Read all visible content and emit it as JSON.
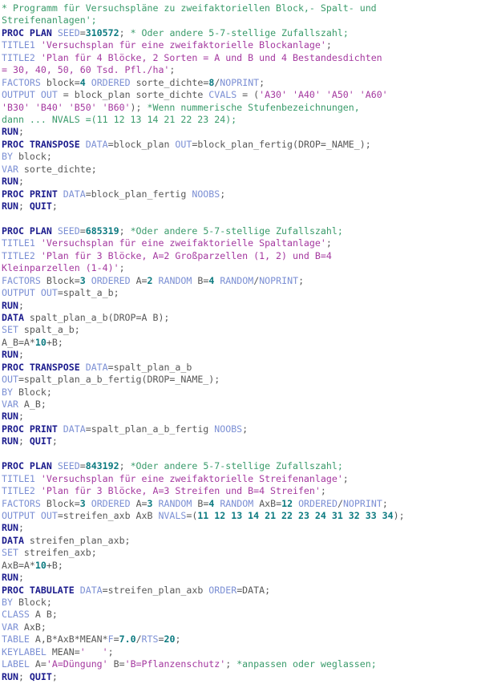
{
  "document": {
    "kind": "sas-program-source-listing",
    "language": "SAS",
    "colors": {
      "background": "#ffffff",
      "keyword": "#1a1a8c",
      "statement": "#7b8fd4",
      "option": "#7b8fd4",
      "number": "#0c7a80",
      "string": "#a4389f",
      "comment": "#3a9b6b",
      "plain": "#575757"
    }
  },
  "lines": [
    {
      "n": 1,
      "tokens": [
        {
          "t": "cmt",
          "v": "* Programm für Versuchspläne zu zweifaktoriellen Block,- Spalt- und"
        }
      ]
    },
    {
      "n": 2,
      "tokens": [
        {
          "t": "cmt",
          "v": "Streifenanlagen';"
        }
      ]
    },
    {
      "n": 3,
      "tokens": [
        {
          "t": "kw",
          "v": "PROC PLAN"
        },
        {
          "t": "plain",
          "v": " "
        },
        {
          "t": "opt",
          "v": "SEED"
        },
        {
          "t": "plain",
          "v": "="
        },
        {
          "t": "num",
          "v": "310572"
        },
        {
          "t": "plain",
          "v": "; "
        },
        {
          "t": "cmt",
          "v": "* Oder andere 5-7-stellige Zufallszahl;"
        }
      ]
    },
    {
      "n": 4,
      "tokens": [
        {
          "t": "stmt",
          "v": "TITLE1"
        },
        {
          "t": "plain",
          "v": " "
        },
        {
          "t": "str",
          "v": "'Versuchsplan für eine zweifaktorielle Blockanlage'"
        },
        {
          "t": "plain",
          "v": ";"
        }
      ]
    },
    {
      "n": 5,
      "tokens": [
        {
          "t": "stmt",
          "v": "TITLE2"
        },
        {
          "t": "plain",
          "v": " "
        },
        {
          "t": "str",
          "v": "'Plan für 4 Blöcke, 2 Sorten = A und B und 4 Bestandesdichten"
        }
      ]
    },
    {
      "n": 6,
      "tokens": [
        {
          "t": "str",
          "v": "= 30, 40, 50, 60 Tsd. Pfl./ha'"
        },
        {
          "t": "plain",
          "v": ";"
        }
      ]
    },
    {
      "n": 7,
      "tokens": [
        {
          "t": "stmt",
          "v": "FACTORS"
        },
        {
          "t": "plain",
          "v": " block="
        },
        {
          "t": "num",
          "v": "4"
        },
        {
          "t": "plain",
          "v": " "
        },
        {
          "t": "stmt",
          "v": "ORDERED"
        },
        {
          "t": "plain",
          "v": " sorte_dichte="
        },
        {
          "t": "num",
          "v": "8"
        },
        {
          "t": "plain",
          "v": "/"
        },
        {
          "t": "stmt",
          "v": "NOPRINT"
        },
        {
          "t": "plain",
          "v": ";"
        }
      ]
    },
    {
      "n": 8,
      "tokens": [
        {
          "t": "stmt",
          "v": "OUTPUT OUT"
        },
        {
          "t": "plain",
          "v": " = block_plan sorte_dichte "
        },
        {
          "t": "stmt",
          "v": "CVALS"
        },
        {
          "t": "plain",
          "v": " = ("
        },
        {
          "t": "str",
          "v": "'A30' 'A40' 'A50' 'A60'"
        }
      ]
    },
    {
      "n": 9,
      "tokens": [
        {
          "t": "str",
          "v": "'B30' 'B40' 'B50' 'B60'"
        },
        {
          "t": "plain",
          "v": "); "
        },
        {
          "t": "cmt",
          "v": "*Wenn nummerische Stufenbezeichnungen,"
        }
      ]
    },
    {
      "n": 10,
      "tokens": [
        {
          "t": "cmt",
          "v": "dann ... NVALS =(11 12 13 14 21 22 23 24);"
        }
      ]
    },
    {
      "n": 11,
      "tokens": [
        {
          "t": "kw",
          "v": "RUN"
        },
        {
          "t": "plain",
          "v": ";"
        }
      ]
    },
    {
      "n": 12,
      "tokens": [
        {
          "t": "kw",
          "v": "PROC TRANSPOSE"
        },
        {
          "t": "plain",
          "v": " "
        },
        {
          "t": "opt",
          "v": "DATA"
        },
        {
          "t": "plain",
          "v": "=block_plan "
        },
        {
          "t": "opt",
          "v": "OUT"
        },
        {
          "t": "plain",
          "v": "=block_plan_fertig(DROP=_NAME_);"
        }
      ]
    },
    {
      "n": 13,
      "tokens": [
        {
          "t": "stmt",
          "v": "BY"
        },
        {
          "t": "plain",
          "v": " block;"
        }
      ]
    },
    {
      "n": 14,
      "tokens": [
        {
          "t": "stmt",
          "v": "VAR"
        },
        {
          "t": "plain",
          "v": " sorte_dichte;"
        }
      ]
    },
    {
      "n": 15,
      "tokens": [
        {
          "t": "kw",
          "v": "RUN"
        },
        {
          "t": "plain",
          "v": ";"
        }
      ]
    },
    {
      "n": 16,
      "tokens": [
        {
          "t": "kw",
          "v": "PROC PRINT"
        },
        {
          "t": "plain",
          "v": " "
        },
        {
          "t": "opt",
          "v": "DATA"
        },
        {
          "t": "plain",
          "v": "=block_plan_fertig "
        },
        {
          "t": "opt",
          "v": "NOOBS"
        },
        {
          "t": "plain",
          "v": ";"
        }
      ]
    },
    {
      "n": 17,
      "tokens": [
        {
          "t": "kw",
          "v": "RUN"
        },
        {
          "t": "plain",
          "v": "; "
        },
        {
          "t": "kw",
          "v": "QUIT"
        },
        {
          "t": "plain",
          "v": ";"
        }
      ]
    },
    {
      "n": 18,
      "tokens": []
    },
    {
      "n": 19,
      "tokens": [
        {
          "t": "kw",
          "v": "PROC PLAN"
        },
        {
          "t": "plain",
          "v": " "
        },
        {
          "t": "opt",
          "v": "SEED"
        },
        {
          "t": "plain",
          "v": "="
        },
        {
          "t": "num",
          "v": "685319"
        },
        {
          "t": "plain",
          "v": "; "
        },
        {
          "t": "cmt",
          "v": "*Oder andere 5-7-stellige Zufallszahl;"
        }
      ]
    },
    {
      "n": 20,
      "tokens": [
        {
          "t": "stmt",
          "v": "TITLE1"
        },
        {
          "t": "plain",
          "v": " "
        },
        {
          "t": "str",
          "v": "'Versuchsplan für eine zweifaktorielle Spaltanlage'"
        },
        {
          "t": "plain",
          "v": ";"
        }
      ]
    },
    {
      "n": 21,
      "tokens": [
        {
          "t": "stmt",
          "v": "TITLE2"
        },
        {
          "t": "plain",
          "v": " "
        },
        {
          "t": "str",
          "v": "'Plan für 3 Blöcke, A=2 Großparzellen (1, 2) und B=4"
        }
      ]
    },
    {
      "n": 22,
      "tokens": [
        {
          "t": "str",
          "v": "Kleinparzellen (1-4)'"
        },
        {
          "t": "plain",
          "v": ";"
        }
      ]
    },
    {
      "n": 23,
      "tokens": [
        {
          "t": "stmt",
          "v": "FACTORS"
        },
        {
          "t": "plain",
          "v": " Block="
        },
        {
          "t": "num",
          "v": "3"
        },
        {
          "t": "plain",
          "v": " "
        },
        {
          "t": "stmt",
          "v": "ORDERED"
        },
        {
          "t": "plain",
          "v": " A="
        },
        {
          "t": "num",
          "v": "2"
        },
        {
          "t": "plain",
          "v": " "
        },
        {
          "t": "stmt",
          "v": "RANDOM"
        },
        {
          "t": "plain",
          "v": " B="
        },
        {
          "t": "num",
          "v": "4"
        },
        {
          "t": "plain",
          "v": " "
        },
        {
          "t": "stmt",
          "v": "RANDOM"
        },
        {
          "t": "plain",
          "v": "/"
        },
        {
          "t": "stmt",
          "v": "NOPRINT"
        },
        {
          "t": "plain",
          "v": ";"
        }
      ]
    },
    {
      "n": 24,
      "tokens": [
        {
          "t": "stmt",
          "v": "OUTPUT OUT"
        },
        {
          "t": "plain",
          "v": "=spalt_a_b;"
        }
      ]
    },
    {
      "n": 25,
      "tokens": [
        {
          "t": "kw",
          "v": "RUN"
        },
        {
          "t": "plain",
          "v": ";"
        }
      ]
    },
    {
      "n": 26,
      "tokens": [
        {
          "t": "kw",
          "v": "DATA"
        },
        {
          "t": "plain",
          "v": " spalt_plan_a_b(DROP=A B);"
        }
      ]
    },
    {
      "n": 27,
      "tokens": [
        {
          "t": "stmt",
          "v": "SET"
        },
        {
          "t": "plain",
          "v": " spalt_a_b;"
        }
      ]
    },
    {
      "n": 28,
      "tokens": [
        {
          "t": "plain",
          "v": "A_B=A*"
        },
        {
          "t": "num",
          "v": "10"
        },
        {
          "t": "plain",
          "v": "+B;"
        }
      ]
    },
    {
      "n": 29,
      "tokens": [
        {
          "t": "kw",
          "v": "RUN"
        },
        {
          "t": "plain",
          "v": ";"
        }
      ]
    },
    {
      "n": 30,
      "tokens": [
        {
          "t": "kw",
          "v": "PROC TRANSPOSE"
        },
        {
          "t": "plain",
          "v": " "
        },
        {
          "t": "opt",
          "v": "DATA"
        },
        {
          "t": "plain",
          "v": "=spalt_plan_a_b"
        }
      ]
    },
    {
      "n": 31,
      "tokens": [
        {
          "t": "opt",
          "v": "OUT"
        },
        {
          "t": "plain",
          "v": "=spalt_plan_a_b_fertig(DROP=_NAME_);"
        }
      ]
    },
    {
      "n": 32,
      "tokens": [
        {
          "t": "stmt",
          "v": "BY"
        },
        {
          "t": "plain",
          "v": " Block;"
        }
      ]
    },
    {
      "n": 33,
      "tokens": [
        {
          "t": "stmt",
          "v": "VAR"
        },
        {
          "t": "plain",
          "v": " A_B;"
        }
      ]
    },
    {
      "n": 34,
      "tokens": [
        {
          "t": "kw",
          "v": "RUN"
        },
        {
          "t": "plain",
          "v": ";"
        }
      ]
    },
    {
      "n": 35,
      "tokens": [
        {
          "t": "kw",
          "v": "PROC PRINT"
        },
        {
          "t": "plain",
          "v": " "
        },
        {
          "t": "opt",
          "v": "DATA"
        },
        {
          "t": "plain",
          "v": "=spalt_plan_a_b_fertig "
        },
        {
          "t": "opt",
          "v": "NOOBS"
        },
        {
          "t": "plain",
          "v": ";"
        }
      ]
    },
    {
      "n": 36,
      "tokens": [
        {
          "t": "kw",
          "v": "RUN"
        },
        {
          "t": "plain",
          "v": "; "
        },
        {
          "t": "kw",
          "v": "QUIT"
        },
        {
          "t": "plain",
          "v": ";"
        }
      ]
    },
    {
      "n": 37,
      "tokens": []
    },
    {
      "n": 38,
      "tokens": [
        {
          "t": "kw",
          "v": "PROC PLAN"
        },
        {
          "t": "plain",
          "v": " "
        },
        {
          "t": "opt",
          "v": "SEED"
        },
        {
          "t": "plain",
          "v": "="
        },
        {
          "t": "num",
          "v": "843192"
        },
        {
          "t": "plain",
          "v": "; "
        },
        {
          "t": "cmt",
          "v": "*Oder andere 5-7-stellige Zufallszahl;"
        }
      ]
    },
    {
      "n": 39,
      "tokens": [
        {
          "t": "stmt",
          "v": "TITLE1"
        },
        {
          "t": "plain",
          "v": " "
        },
        {
          "t": "str",
          "v": "'Versuchsplan für eine zweifaktorielle Streifenanlage'"
        },
        {
          "t": "plain",
          "v": ";"
        }
      ]
    },
    {
      "n": 40,
      "tokens": [
        {
          "t": "stmt",
          "v": "TITLE2"
        },
        {
          "t": "plain",
          "v": " "
        },
        {
          "t": "str",
          "v": "'Plan für 3 Blöcke, A=3 Streifen und B=4 Streifen'"
        },
        {
          "t": "plain",
          "v": ";"
        }
      ]
    },
    {
      "n": 41,
      "tokens": [
        {
          "t": "stmt",
          "v": "FACTORS"
        },
        {
          "t": "plain",
          "v": " Block="
        },
        {
          "t": "num",
          "v": "3"
        },
        {
          "t": "plain",
          "v": " "
        },
        {
          "t": "stmt",
          "v": "ORDERED"
        },
        {
          "t": "plain",
          "v": " A="
        },
        {
          "t": "num",
          "v": "3"
        },
        {
          "t": "plain",
          "v": " "
        },
        {
          "t": "stmt",
          "v": "RANDOM"
        },
        {
          "t": "plain",
          "v": " B="
        },
        {
          "t": "num",
          "v": "4"
        },
        {
          "t": "plain",
          "v": " "
        },
        {
          "t": "stmt",
          "v": "RANDOM"
        },
        {
          "t": "plain",
          "v": " AxB="
        },
        {
          "t": "num",
          "v": "12"
        },
        {
          "t": "plain",
          "v": " "
        },
        {
          "t": "stmt",
          "v": "ORDERED"
        },
        {
          "t": "plain",
          "v": "/"
        },
        {
          "t": "stmt",
          "v": "NOPRINT"
        },
        {
          "t": "plain",
          "v": ";"
        }
      ]
    },
    {
      "n": 42,
      "tokens": [
        {
          "t": "stmt",
          "v": "OUTPUT OUT"
        },
        {
          "t": "plain",
          "v": "=streifen_axb AxB "
        },
        {
          "t": "stmt",
          "v": "NVALS"
        },
        {
          "t": "plain",
          "v": "=("
        },
        {
          "t": "num",
          "v": "11 12 13 14 21 22 23 24 31 32 33 34"
        },
        {
          "t": "plain",
          "v": ");"
        }
      ]
    },
    {
      "n": 43,
      "tokens": [
        {
          "t": "kw",
          "v": "RUN"
        },
        {
          "t": "plain",
          "v": ";"
        }
      ]
    },
    {
      "n": 44,
      "tokens": [
        {
          "t": "kw",
          "v": "DATA"
        },
        {
          "t": "plain",
          "v": " streifen_plan_axb;"
        }
      ]
    },
    {
      "n": 45,
      "tokens": [
        {
          "t": "stmt",
          "v": "SET"
        },
        {
          "t": "plain",
          "v": " streifen_axb;"
        }
      ]
    },
    {
      "n": 46,
      "tokens": [
        {
          "t": "plain",
          "v": "AxB=A*"
        },
        {
          "t": "num",
          "v": "10"
        },
        {
          "t": "plain",
          "v": "+B;"
        }
      ]
    },
    {
      "n": 47,
      "tokens": [
        {
          "t": "kw",
          "v": "RUN"
        },
        {
          "t": "plain",
          "v": ";"
        }
      ]
    },
    {
      "n": 48,
      "tokens": [
        {
          "t": "kw",
          "v": "PROC TABULATE"
        },
        {
          "t": "plain",
          "v": " "
        },
        {
          "t": "opt",
          "v": "DATA"
        },
        {
          "t": "plain",
          "v": "=streifen_plan_axb "
        },
        {
          "t": "opt",
          "v": "ORDER"
        },
        {
          "t": "plain",
          "v": "=DATA;"
        }
      ]
    },
    {
      "n": 49,
      "tokens": [
        {
          "t": "stmt",
          "v": "BY"
        },
        {
          "t": "plain",
          "v": " Block;"
        }
      ]
    },
    {
      "n": 50,
      "tokens": [
        {
          "t": "stmt",
          "v": "CLASS"
        },
        {
          "t": "plain",
          "v": " A B;"
        }
      ]
    },
    {
      "n": 51,
      "tokens": [
        {
          "t": "stmt",
          "v": "VAR"
        },
        {
          "t": "plain",
          "v": " AxB;"
        }
      ]
    },
    {
      "n": 52,
      "tokens": [
        {
          "t": "stmt",
          "v": "TABLE"
        },
        {
          "t": "plain",
          "v": " A,B*AxB*MEAN*"
        },
        {
          "t": "opt",
          "v": "F"
        },
        {
          "t": "plain",
          "v": "="
        },
        {
          "t": "num",
          "v": "7.0"
        },
        {
          "t": "plain",
          "v": "/"
        },
        {
          "t": "opt",
          "v": "RTS"
        },
        {
          "t": "plain",
          "v": "="
        },
        {
          "t": "num",
          "v": "20"
        },
        {
          "t": "plain",
          "v": ";"
        }
      ]
    },
    {
      "n": 53,
      "tokens": [
        {
          "t": "stmt",
          "v": "KEYLABEL"
        },
        {
          "t": "plain",
          "v": " MEAN="
        },
        {
          "t": "str",
          "v": "'   '"
        },
        {
          "t": "plain",
          "v": ";"
        }
      ]
    },
    {
      "n": 54,
      "tokens": [
        {
          "t": "stmt",
          "v": "LABEL"
        },
        {
          "t": "plain",
          "v": " A="
        },
        {
          "t": "str",
          "v": "'A=Düngung'"
        },
        {
          "t": "plain",
          "v": " B="
        },
        {
          "t": "str",
          "v": "'B=Pflanzenschutz'"
        },
        {
          "t": "plain",
          "v": "; "
        },
        {
          "t": "cmt",
          "v": "*anpassen oder weglassen;"
        }
      ]
    },
    {
      "n": 55,
      "tokens": [
        {
          "t": "kw",
          "v": "RUN"
        },
        {
          "t": "plain",
          "v": "; "
        },
        {
          "t": "kw",
          "v": "QUIT"
        },
        {
          "t": "plain",
          "v": ";"
        }
      ]
    }
  ]
}
